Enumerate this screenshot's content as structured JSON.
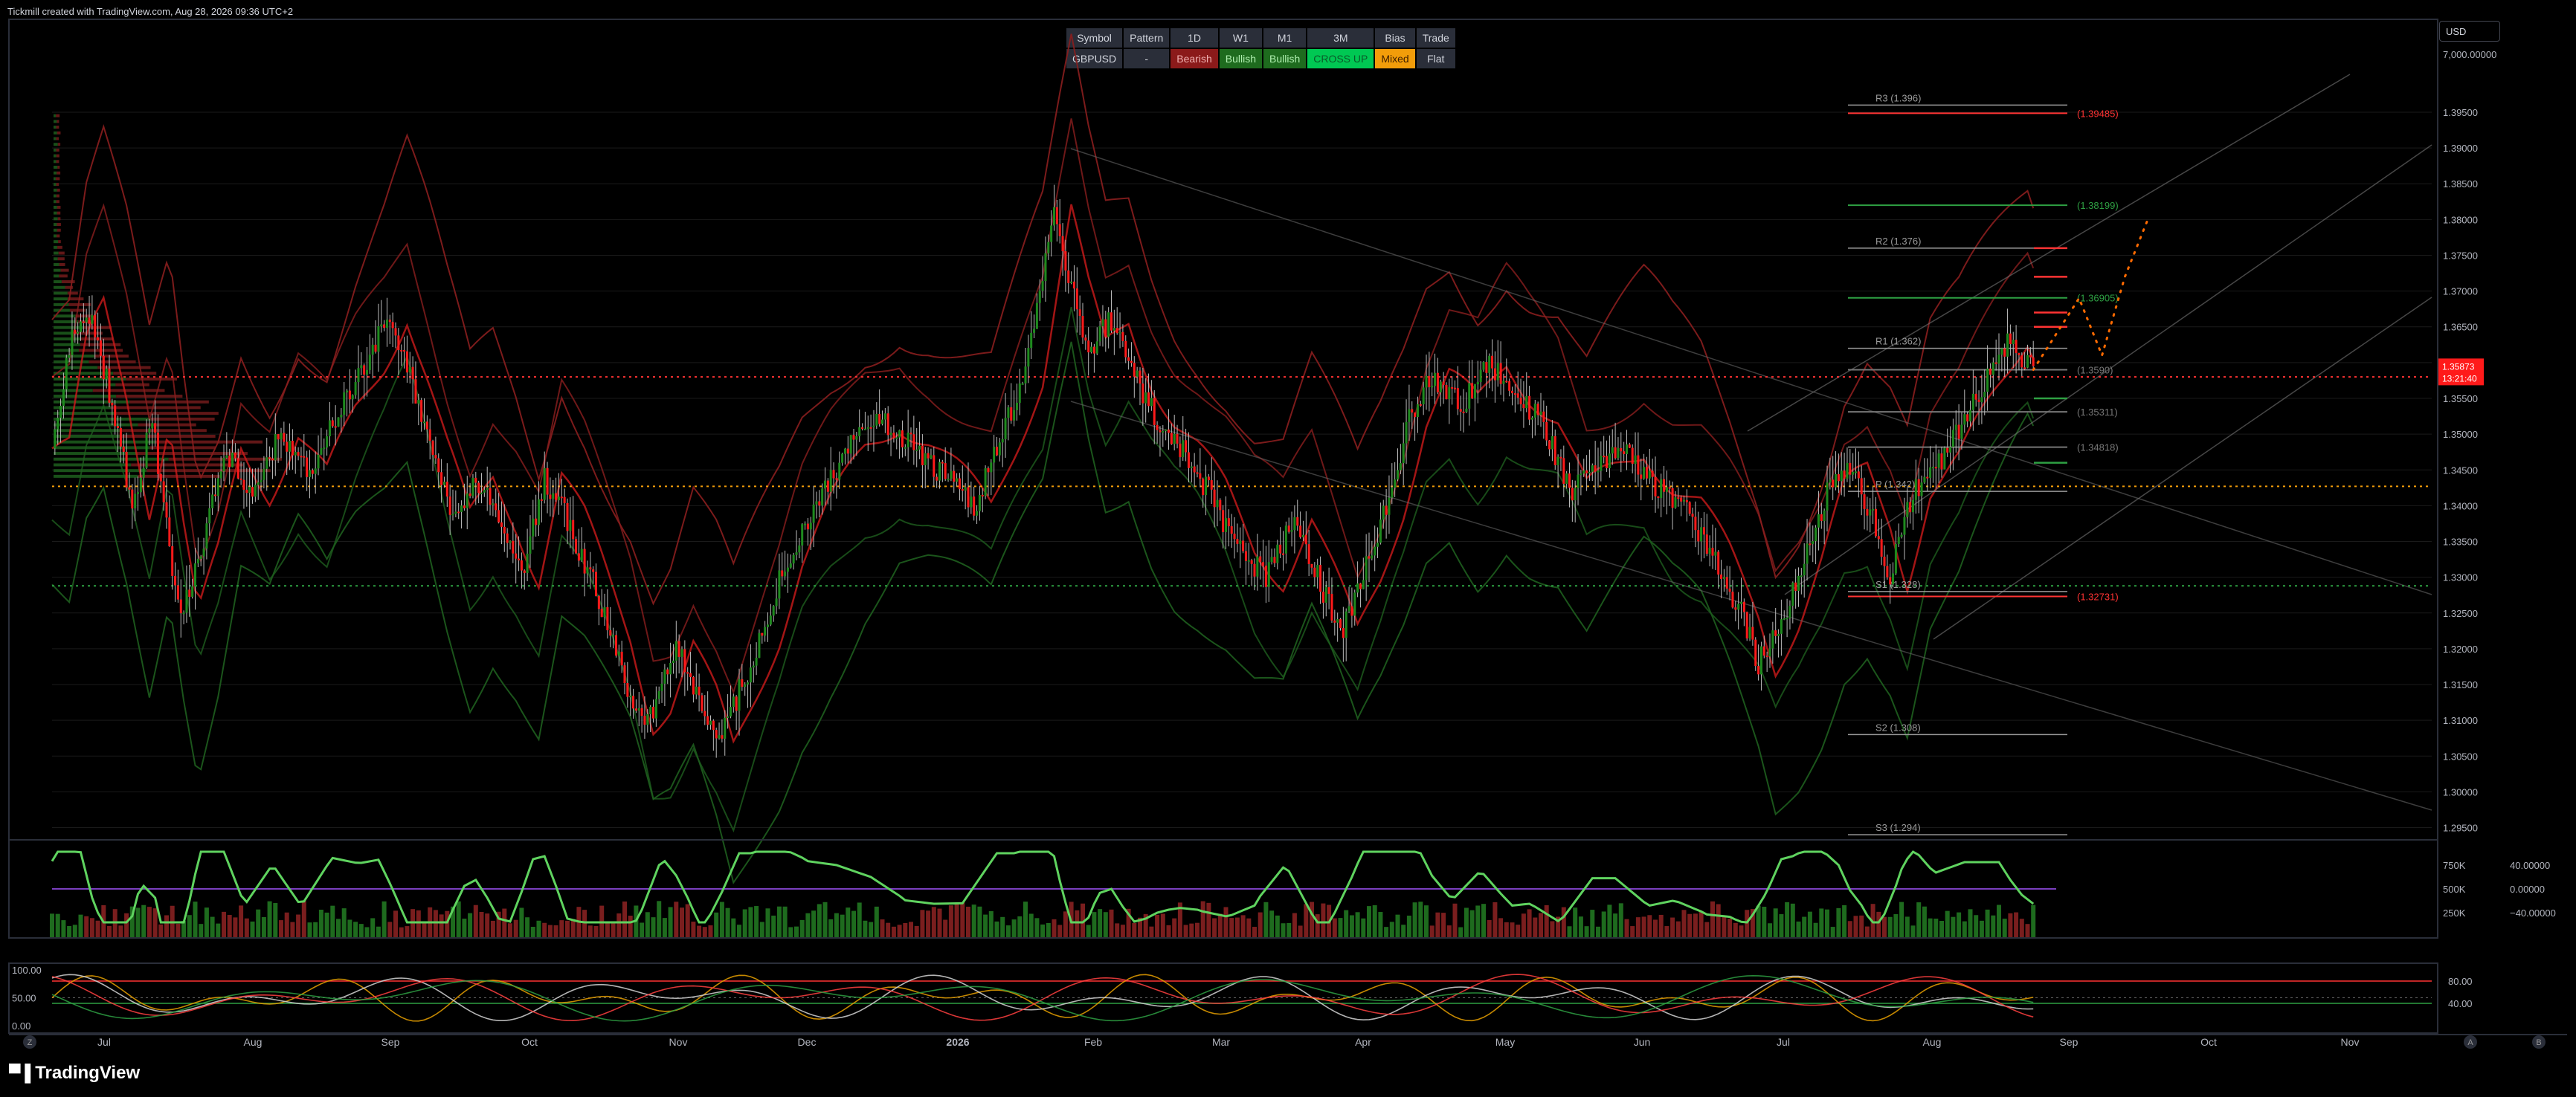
{
  "credit": "Tickmill created with TradingView.com, Aug 28, 2026 09:36 UTC+2",
  "currency": "USD",
  "brand": "TradingView",
  "status_table": {
    "headers": [
      "Symbol",
      "Pattern",
      "1D",
      "W1",
      "M1",
      "3M",
      "Bias",
      "Trade"
    ],
    "values": [
      "GBPUSD",
      "-",
      "Bearish",
      "Bullish",
      "Bullish",
      "CROSS UP",
      "Mixed",
      "Flat"
    ],
    "colors": [
      "#2a2e39",
      "#2a2e39",
      "#8b1a1a",
      "#1e6b1e",
      "#1e6b1e",
      "#00c853",
      "#f29d0a",
      "#2a2e39"
    ],
    "text_colors": [
      "#d1d4dc",
      "#d1d4dc",
      "#f0b0b0",
      "#b0f0b0",
      "#b0f0b0",
      "#0a5a2a",
      "#402000",
      "#d1d4dc"
    ]
  },
  "colors": {
    "up": "#1e8a1e",
    "down": "#ff1a1a",
    "grid": "#1a1a1a",
    "pivot_line": "#9a9a9a",
    "red_level": "#ff3333",
    "green_level": "#2ea043",
    "price_tag": "#ff1a1a",
    "orange_dot": "#ff6a00"
  },
  "chart_data": [
    {
      "type": "candlestick",
      "symbol": "GBPUSD",
      "title": "",
      "y_axis_ticks": [
        "1.39500",
        "1.39000",
        "1.38500",
        "1.38000",
        "1.37500",
        "1.37000",
        "1.36500",
        "1.36000",
        "1.35500",
        "1.35000",
        "1.34500",
        "1.34000",
        "1.33500",
        "1.33000",
        "1.32500",
        "1.32000",
        "1.31500",
        "1.31000",
        "1.30500",
        "1.30000",
        "1.29500"
      ],
      "volume_axis_label": "7,000.00000",
      "ylim": [
        1.2935,
        1.4005
      ],
      "x_axis_ticks": [
        "Jul",
        "Aug",
        "Sep",
        "Oct",
        "Nov",
        "Dec",
        "2026",
        "Feb",
        "Mar",
        "Apr",
        "May",
        "Jun",
        "Jul",
        "Aug",
        "Sep",
        "Oct",
        "Nov"
      ],
      "x_axis_corner_labels": [
        "Z",
        "A",
        "B"
      ],
      "last_price": "1.35873",
      "countdown": "13:21:40",
      "price_path": [
        [
          0,
          1.348
        ],
        [
          6,
          1.362
        ],
        [
          12,
          1.368
        ],
        [
          20,
          1.356
        ],
        [
          28,
          1.34
        ],
        [
          35,
          1.352
        ],
        [
          40,
          1.337
        ],
        [
          45,
          1.324
        ],
        [
          52,
          1.333
        ],
        [
          60,
          1.348
        ],
        [
          70,
          1.342
        ],
        [
          80,
          1.35
        ],
        [
          90,
          1.344
        ],
        [
          100,
          1.353
        ],
        [
          110,
          1.36
        ],
        [
          118,
          1.367
        ],
        [
          125,
          1.358
        ],
        [
          132,
          1.348
        ],
        [
          140,
          1.338
        ],
        [
          148,
          1.344
        ],
        [
          156,
          1.338
        ],
        [
          164,
          1.33
        ],
        [
          172,
          1.344
        ],
        [
          180,
          1.338
        ],
        [
          188,
          1.33
        ],
        [
          196,
          1.322
        ],
        [
          204,
          1.31
        ],
        [
          210,
          1.312
        ],
        [
          218,
          1.32
        ],
        [
          226,
          1.313
        ],
        [
          232,
          1.306
        ],
        [
          240,
          1.314
        ],
        [
          248,
          1.322
        ],
        [
          256,
          1.332
        ],
        [
          266,
          1.34
        ],
        [
          278,
          1.348
        ],
        [
          290,
          1.352
        ],
        [
          300,
          1.349
        ],
        [
          312,
          1.344
        ],
        [
          322,
          1.34
        ],
        [
          330,
          1.348
        ],
        [
          340,
          1.358
        ],
        [
          346,
          1.372
        ],
        [
          350,
          1.381
        ],
        [
          356,
          1.37
        ],
        [
          362,
          1.362
        ],
        [
          370,
          1.366
        ],
        [
          378,
          1.358
        ],
        [
          386,
          1.352
        ],
        [
          394,
          1.348
        ],
        [
          404,
          1.342
        ],
        [
          414,
          1.334
        ],
        [
          424,
          1.33
        ],
        [
          434,
          1.338
        ],
        [
          442,
          1.33
        ],
        [
          450,
          1.322
        ],
        [
          458,
          1.33
        ],
        [
          466,
          1.34
        ],
        [
          474,
          1.352
        ],
        [
          482,
          1.358
        ],
        [
          492,
          1.354
        ],
        [
          502,
          1.36
        ],
        [
          510,
          1.356
        ],
        [
          520,
          1.352
        ],
        [
          530,
          1.342
        ],
        [
          540,
          1.345
        ],
        [
          550,
          1.348
        ],
        [
          560,
          1.343
        ],
        [
          570,
          1.34
        ],
        [
          580,
          1.333
        ],
        [
          590,
          1.325
        ],
        [
          596,
          1.318
        ],
        [
          604,
          1.324
        ],
        [
          612,
          1.332
        ],
        [
          620,
          1.342
        ],
        [
          628,
          1.345
        ],
        [
          636,
          1.338
        ],
        [
          642,
          1.33
        ],
        [
          650,
          1.342
        ],
        [
          660,
          1.346
        ],
        [
          668,
          1.352
        ],
        [
          676,
          1.358
        ],
        [
          684,
          1.364
        ],
        [
          688,
          1.361
        ],
        [
          692,
          1.359
        ]
      ],
      "pivots": [
        {
          "label": "R3 (1.396)",
          "value": 1.396
        },
        {
          "label": "R2 (1.376)",
          "value": 1.376
        },
        {
          "label": "R1 (1.362)",
          "value": 1.362
        },
        {
          "label": "P (1.342)",
          "value": 1.342
        },
        {
          "label": "S1 (1.328)",
          "value": 1.328
        },
        {
          "label": "S2 (1.308)",
          "value": 1.308
        },
        {
          "label": "S3 (1.294)",
          "value": 1.294
        }
      ],
      "level_labels": [
        {
          "label": "(1.39485)",
          "value": 1.39485,
          "color": "red"
        },
        {
          "label": "(1.38199)",
          "value": 1.38199,
          "color": "green"
        },
        {
          "label": "(1.36905)",
          "value": 1.36905,
          "color": "green"
        },
        {
          "label": "(1.3590)",
          "value": 1.359,
          "color": "grey"
        },
        {
          "label": "(1.35311)",
          "value": 1.35311,
          "color": "grey"
        },
        {
          "label": "(1.34818)",
          "value": 1.34818,
          "color": "grey"
        },
        {
          "label": "(1.32731)",
          "value": 1.32731,
          "color": "red"
        }
      ],
      "dotted_levels": [
        {
          "value": 1.358,
          "color": "red"
        },
        {
          "value": 1.3427,
          "color": "orange"
        },
        {
          "value": 1.3288,
          "color": "green"
        }
      ],
      "projection": [
        [
          692,
          1.359
        ],
        [
          700,
          1.364
        ],
        [
          708,
          1.369
        ],
        [
          716,
          1.361
        ],
        [
          724,
          1.372
        ],
        [
          732,
          1.38
        ]
      ]
    },
    {
      "type": "bar",
      "title": "",
      "axis_labels_left": [
        "750K",
        "500K",
        "250K"
      ],
      "axis_labels_right": [
        "40.00000",
        "0.00000",
        "−40.00000"
      ]
    },
    {
      "type": "line",
      "title": "",
      "axis_labels_left": [
        "100.00",
        "50.00",
        "0.00"
      ],
      "axis_labels_right": [
        "80.00",
        "40.00"
      ]
    }
  ]
}
